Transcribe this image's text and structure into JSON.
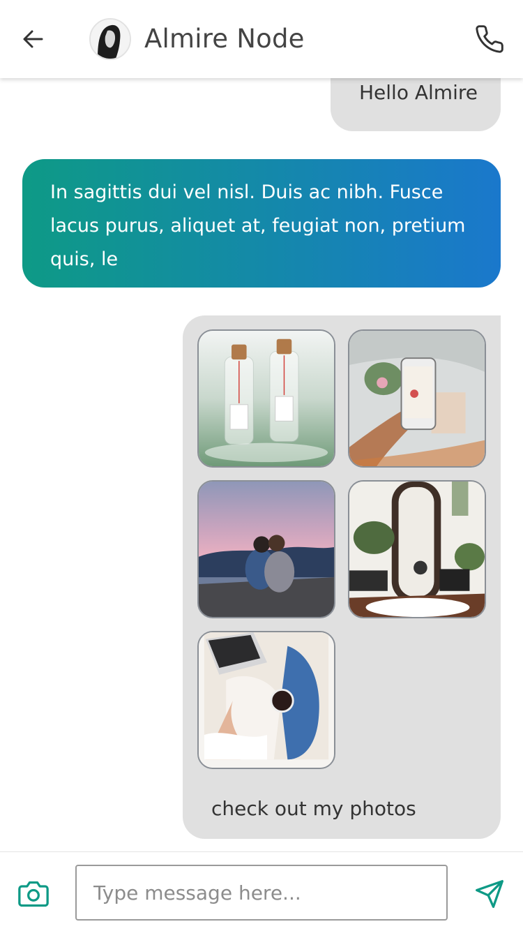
{
  "header": {
    "contact_name": "Almire Node"
  },
  "messages": [
    {
      "direction": "outgoing",
      "text": "Hello Almire"
    },
    {
      "direction": "incoming",
      "text": "In sagittis dui vel nisl. Duis ac nibh. Fusce lacus purus, aliquet at, feugiat non, pretium quis, le"
    },
    {
      "direction": "outgoing",
      "photos": [
        "glass-bottles-photo",
        "phone-photo-bed-photo",
        "couple-sunset-mountains-photo",
        "mirror-plants-room-photo",
        "laptop-coffee-photo"
      ],
      "caption": "check out my photos"
    }
  ],
  "composer": {
    "placeholder": "Type message here..."
  },
  "icons": {
    "back": "arrow-left-icon",
    "call": "phone-icon",
    "camera": "camera-icon",
    "send": "send-icon"
  },
  "colors": {
    "accent": "#0e9a86",
    "gradient_start": "#0e9a86",
    "gradient_end": "#1a78cc",
    "bubble_gray": "#e0e0e0"
  }
}
